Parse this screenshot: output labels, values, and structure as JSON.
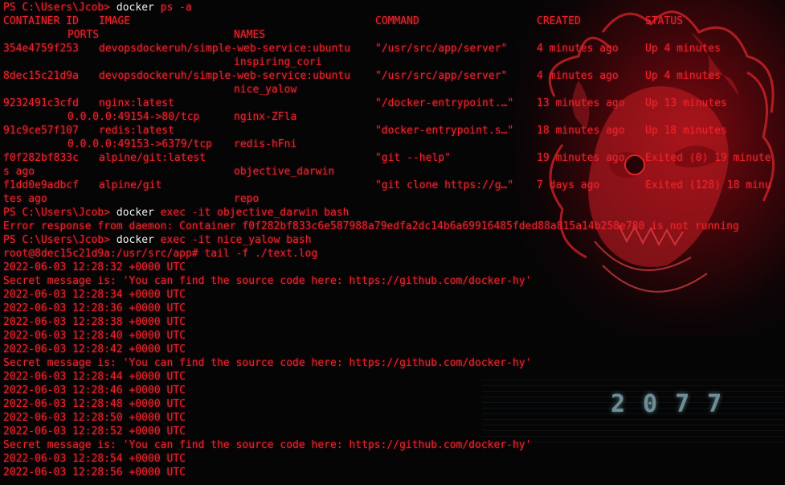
{
  "colors": {
    "terminal_text": "#e8242c",
    "command_highlight": "#f2f2f2",
    "background": "#050506",
    "logo_text": "#6e8d94"
  },
  "wallpaper": {
    "logo_text": "2077"
  },
  "ps_cmd": {
    "prompt": "PS C:\\Users\\Jcob>",
    "cmd": "docker",
    "args": "ps -a"
  },
  "headers": {
    "container_id": "CONTAINER ID",
    "image": "IMAGE",
    "command": "COMMAND",
    "created": "CREATED",
    "status": "STATUS",
    "ports": "PORTS",
    "names": "NAMES"
  },
  "rows": [
    {
      "id": "354e4759f253",
      "image": "devopsdockeruh/simple-web-service:ubuntu",
      "command": "\"/usr/src/app/server\"",
      "created": "4 minutes ago",
      "status": "Up 4 minutes",
      "ports": "",
      "name": "inspiring_cori"
    },
    {
      "id": "8dec15c21d9a",
      "image": "devopsdockeruh/simple-web-service:ubuntu",
      "command": "\"/usr/src/app/server\"",
      "created": "4 minutes ago",
      "status": "Up 4 minutes",
      "ports": "",
      "name": "nice_yalow"
    },
    {
      "id": "9232491c3cfd",
      "image": "nginx:latest",
      "command": "\"/docker-entrypoint.…\"",
      "created": "13 minutes ago",
      "status": "Up 13 minutes",
      "ports": "0.0.0.0:49154->80/tcp",
      "name": "nginx-ZFla"
    },
    {
      "id": "91c9ce57f107",
      "image": "redis:latest",
      "command": "\"docker-entrypoint.s…\"",
      "created": "18 minutes ago",
      "status": "Up 18 minutes",
      "ports": "0.0.0.0:49153->6379/tcp",
      "name": "redis-hFni"
    },
    {
      "id": "f0f282bf833c",
      "image": "alpine/git:latest",
      "command": "\"git --help\"",
      "created": "19 minutes ago",
      "status": "Exited (0) 19 minute",
      "status_wrap": "s ago",
      "ports": "",
      "name": "objective_darwin"
    },
    {
      "id": "f1dd0e9adbcf",
      "image": "alpine/git",
      "command": "\"git clone https://g…\"",
      "created": "7 days ago",
      "status": "Exited (128) 18 minu",
      "status_wrap": "tes ago",
      "ports": "",
      "name": "repo"
    }
  ],
  "exec1": {
    "prompt": "PS C:\\Users\\Jcob>",
    "cmd": "docker",
    "args": "exec -it objective_darwin bash"
  },
  "error_line": "Error response from daemon: Container f0f282bf833c6e587988a79edfa2dc14b6a69916485fded88a815a14b258e780 is not running",
  "exec2": {
    "prompt": "PS C:\\Users\\Jcob>",
    "cmd": "docker",
    "args": "exec -it nice_yalow bash"
  },
  "tail_cmd": "root@8dec15c21d9a:/usr/src/app# tail -f ./text.log",
  "log_lines": [
    "2022-06-03 12:28:32 +0000 UTC",
    "Secret message is: 'You can find the source code here: https://github.com/docker-hy'",
    "2022-06-03 12:28:34 +0000 UTC",
    "2022-06-03 12:28:36 +0000 UTC",
    "2022-06-03 12:28:38 +0000 UTC",
    "2022-06-03 12:28:40 +0000 UTC",
    "2022-06-03 12:28:42 +0000 UTC",
    "Secret message is: 'You can find the source code here: https://github.com/docker-hy'",
    "2022-06-03 12:28:44 +0000 UTC",
    "2022-06-03 12:28:46 +0000 UTC",
    "2022-06-03 12:28:48 +0000 UTC",
    "2022-06-03 12:28:50 +0000 UTC",
    "2022-06-03 12:28:52 +0000 UTC",
    "Secret message is: 'You can find the source code here: https://github.com/docker-hy'",
    "2022-06-03 12:28:54 +0000 UTC",
    "2022-06-03 12:28:56 +0000 UTC"
  ]
}
